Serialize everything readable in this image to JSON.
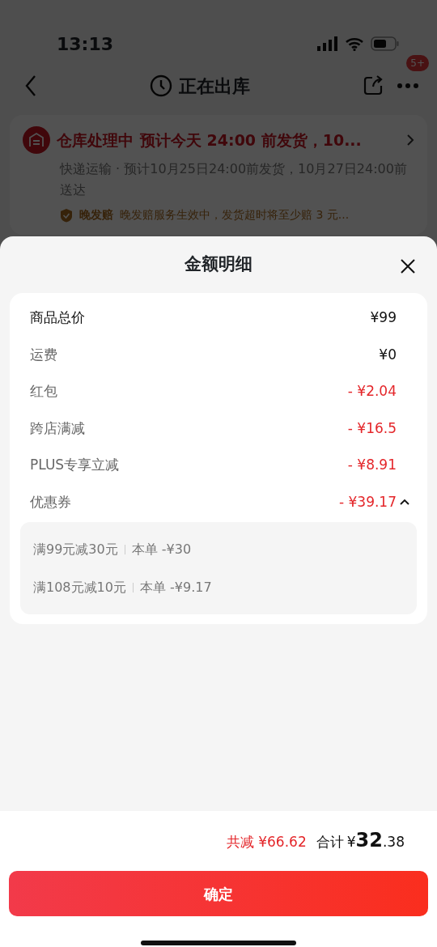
{
  "status_bar": {
    "time": "13:13"
  },
  "header": {
    "title": "正在出库",
    "badge": "5+"
  },
  "order_card": {
    "status": "仓库处理中",
    "headline": "预计今天 24:00 前发货，10...",
    "detail": "快递运输 · 预计10月25日24:00前发货，10月27日24:00前送达",
    "guarantee_label": "晚发赔",
    "guarantee_text": "晚发赔服务生效中，发货超时将至少赔 3 元..."
  },
  "sheet": {
    "title": "金额明细",
    "rows": [
      {
        "kind": "total",
        "label": "商品总价",
        "value": "¥99"
      },
      {
        "kind": "fee",
        "label": "运费",
        "value": "¥0"
      },
      {
        "kind": "discount",
        "label": "红包",
        "value": "- ¥2.04"
      },
      {
        "kind": "discount",
        "label": "跨店满减",
        "value": "- ¥16.5"
      },
      {
        "kind": "discount",
        "label": "PLUS专享立减",
        "value": "- ¥8.91"
      },
      {
        "kind": "discount",
        "label": "优惠券",
        "value": "- ¥39.17",
        "expanded": true,
        "details": [
          {
            "rule": "满99元减30元",
            "amount": "本单 -¥30"
          },
          {
            "rule": "满108元减10元",
            "amount": "本单 -¥9.17"
          }
        ]
      }
    ]
  },
  "footer": {
    "saved": "共减 ¥66.62",
    "total_label": "合计",
    "total_currency": "¥",
    "total_integer": "32",
    "total_decimal": ".38",
    "confirm": "确定"
  }
}
